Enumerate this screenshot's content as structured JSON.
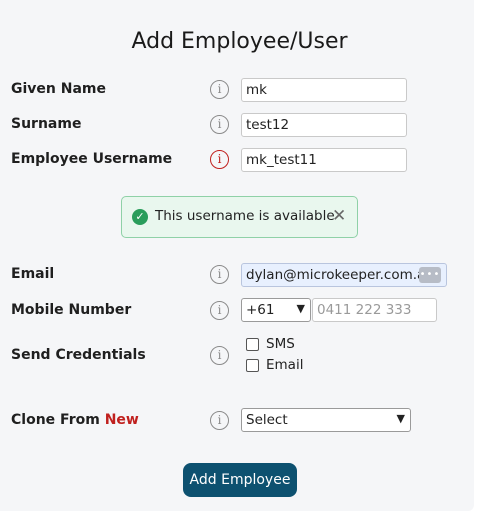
{
  "form": {
    "title": "Add Employee/User",
    "info_glyph": "i",
    "fields": {
      "given_name": {
        "label": "Given Name",
        "value": "mk"
      },
      "surname": {
        "label": "Surname",
        "value": "test12"
      },
      "username": {
        "label": "Employee Username",
        "value": "mk_test11",
        "status_color": "#c0201e"
      },
      "email": {
        "label": "Email",
        "value": "dylan@microkeeper.com.a",
        "autofill_button": "•••"
      },
      "mobile": {
        "label": "Mobile Number",
        "country_code": "+61",
        "placeholder": "0411 222 333"
      },
      "send_credentials": {
        "label": "Send Credentials",
        "options": [
          "SMS",
          "Email"
        ],
        "checked": [
          false,
          false
        ]
      },
      "clone_from": {
        "label": "Clone From",
        "badge": "New",
        "badge_color": "#c0201e",
        "selected": "Select"
      }
    },
    "availability_alert": {
      "message": "This username is available",
      "check_icon": "check-circle-icon",
      "close_icon": "close-icon",
      "color": "#2a9d5b"
    },
    "submit_label": "Add Employee",
    "submit_color": "#0d5170"
  }
}
